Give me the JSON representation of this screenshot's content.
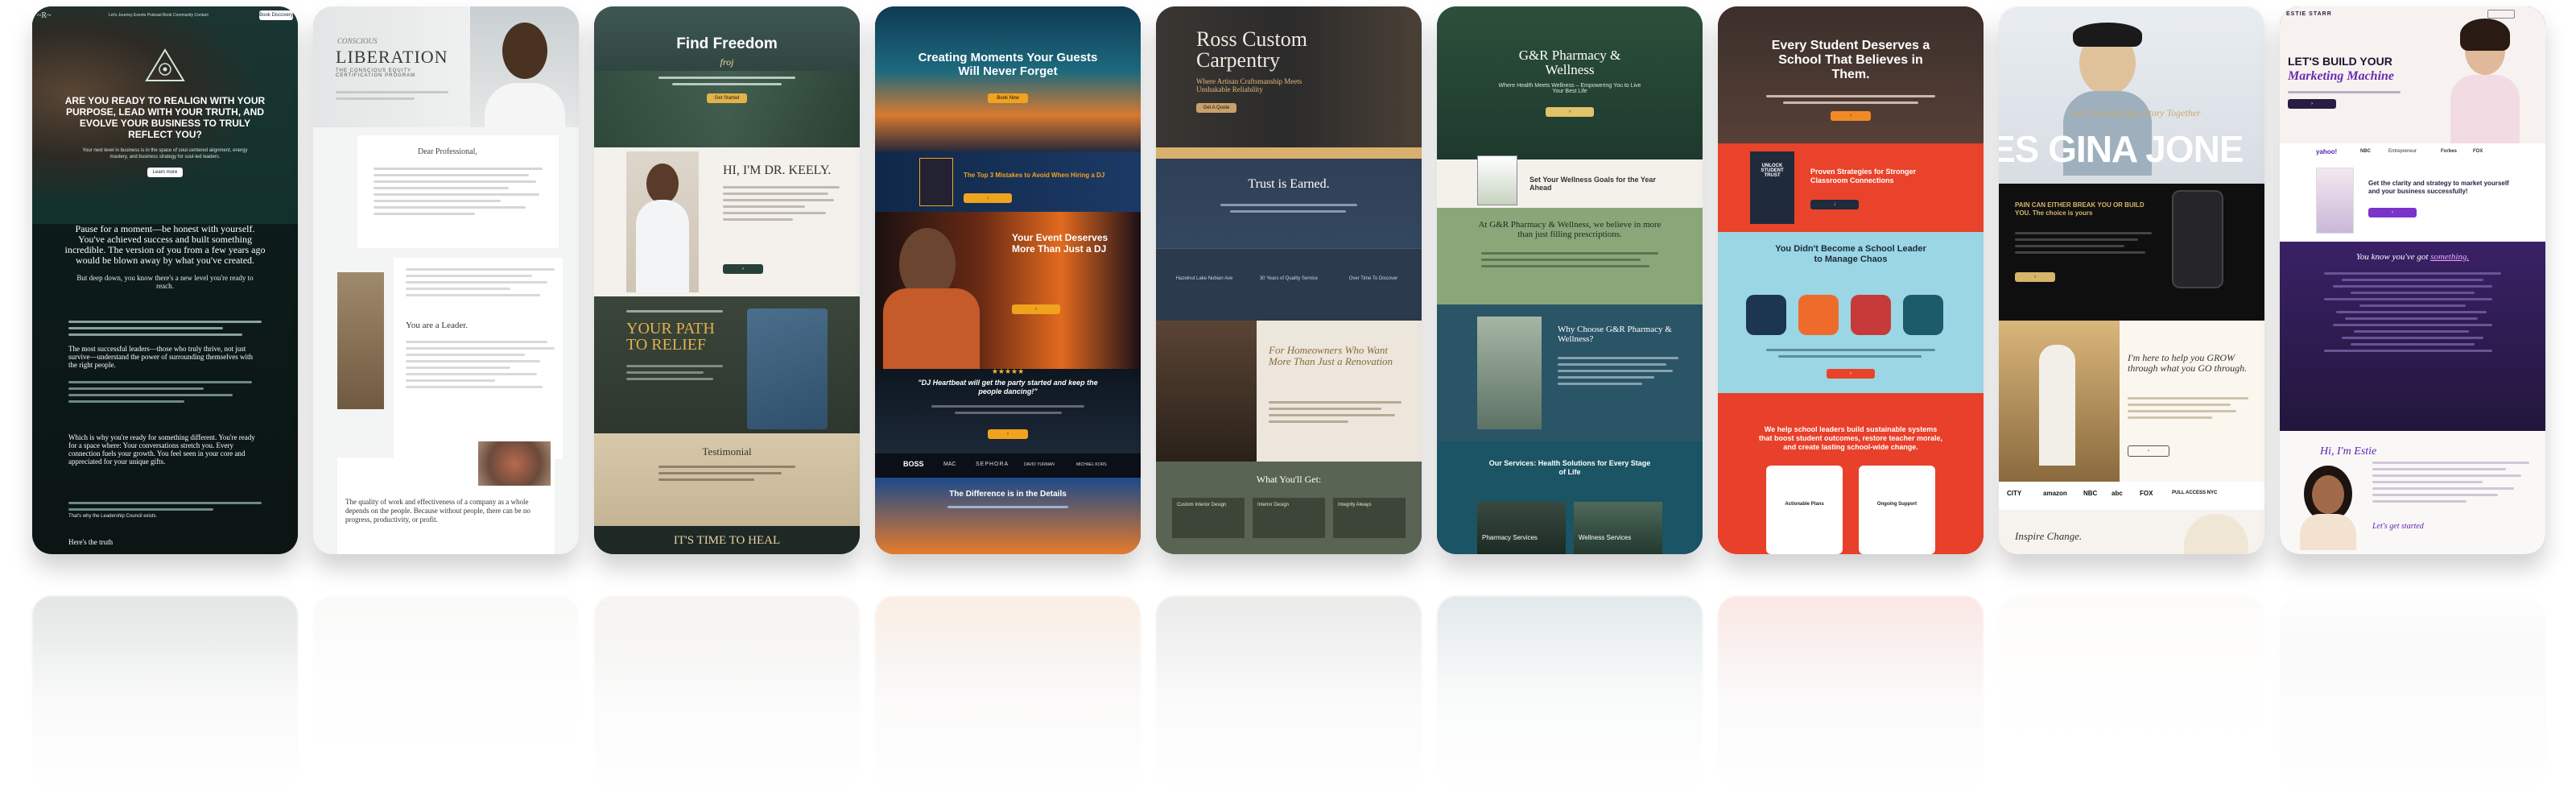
{
  "cards": [
    {
      "id": "soul-business",
      "nav_items": "Let's Journey  Events  Podcast  Book  Community  Contact",
      "nav_button": "Book Discovery",
      "headline": "ARE YOU READY TO REALIGN WITH YOUR PURPOSE, LEAD WITH YOUR TRUTH, AND EVOLVE YOUR BUSINESS TO TRULY REFLECT YOU?",
      "sub": "Your next level in business is in the space of soul-centered alignment, energy mastery, and business strategy for soul-led leaders.",
      "cta": "Learn more",
      "body_heading": "Pause for a moment—be honest with yourself. You've achieved success and built something incredible. The version of you from a few years ago would be blown away by what you've created.",
      "body_line": "But deep down, you know there's a new level you're ready to reach.",
      "quote1": "The most successful leaders—those who truly thrive, not just survive—understand the power of surrounding themselves with the right people.",
      "quote2": "Which is why you're ready for something different. You're ready for a space where: Your conversations stretch you. Every connection fuels your growth. You feel seen in your core and appreciated for your unique gifts.",
      "section": "That's why the Leadership Council exists.",
      "quote3": "Here's the truth"
    },
    {
      "id": "liberation",
      "brand_small": "CONSCIOUS",
      "title": "LIBERATION",
      "subtitle": "THE CONSCIOUS EQUITY CERTIFICATION PROGRAM",
      "greeting": "Dear Professional,",
      "section": "You are a Leader.",
      "quote": "The quality of work and effectiveness of a company as a whole depends on the people. Because without people, there can be no progress, productivity, or profit."
    },
    {
      "id": "find-freedom",
      "title": "Find Freedom",
      "script": "froj",
      "cta": "Get Started",
      "hi": "HI, I'M DR. KEELY.",
      "path1": "YOUR PATH",
      "path2": "TO RELIEF",
      "testimonial": "Testimonial",
      "bottom": "IT'S TIME TO HEAL"
    },
    {
      "id": "dj-events",
      "title": "Creating Moments Your Guests Will Never Forget",
      "cta": "Book Now",
      "promo": "The Top 3 Mistakes to Avoid When Hiring a DJ",
      "event": "Your Event Deserves More Than Just a DJ",
      "stars": "★★★★★",
      "review": "\"DJ Heartbeat will get the party started and keep the people dancing!\"",
      "logos": [
        "BOSS",
        "MAC",
        "SEPHORA",
        "DAVID YURMAN",
        "MICHAEL KORS"
      ],
      "difference": "The Difference is in the Details"
    },
    {
      "id": "ross-carpentry",
      "title1": "Ross Custom",
      "title2": "Carpentry",
      "tagline": "Where Artisan Craftsmanship Meets Unshakable Reliability",
      "cta": "Get A Quote",
      "trust": "Trust is Earned.",
      "stats": [
        "Hazelnut Lake Nubian Ave",
        "30 Years of Quality Service",
        "Over Time To Discover"
      ],
      "homeowners": "For Homeowners Who Want More Than Just a Renovation",
      "get": "What You'll Get:",
      "items": [
        "Custom Interior Design",
        "Interior Design",
        "Integrity Always"
      ]
    },
    {
      "id": "gr-pharmacy",
      "title": "G&R Pharmacy & Wellness",
      "tagline": "Where Health Meets Wellness – Empowering You to Live Your Best Life",
      "book": "Set Your Wellness Goals for the Year Ahead",
      "believe": "At G&R Pharmacy & Wellness, we believe in more than just filling prescriptions.",
      "why": "Why Choose G&R Pharmacy & Wellness?",
      "services": "Our Services: Health Solutions for Every Stage of Life",
      "cards": [
        "Pharmacy Services",
        "Wellness Services"
      ]
    },
    {
      "id": "every-student",
      "title": "Every Student Deserves a School That Believes in Them.",
      "book": "UNLOCK STUDENT TRUST",
      "proven": "Proven Strategies for Stronger Classroom Connections",
      "chaos": "You Didn't Become a School Leader to Manage Chaos",
      "mission": "We help school leaders build sustainable systems that boost student outcomes, restore teacher morale, and create lasting school-wide change.",
      "tiles": [
        "Actionable Plans",
        "Ongoing Support"
      ]
    },
    {
      "id": "gina-jones",
      "marquee": "ES GINA JONE",
      "script": "Let's Rewrite Your Story Together",
      "quote": "PAIN CAN EITHER BREAK YOU OR BUILD YOU. The choice is yours",
      "help": "I'm here to help you GROW through what you GO through.",
      "logos": [
        "CITY",
        "amazon",
        "NBC",
        "abc",
        "FOX",
        "PULL ACCESS NYC"
      ],
      "inspire": "Inspire Change."
    },
    {
      "id": "estie-starr",
      "logo": "ESTIE STARR",
      "title": "LET'S BUILD YOUR",
      "title_script": "Marketing Machine",
      "logos": [
        "yahoo!",
        "NBC",
        "Entrepreneur",
        "Forbes",
        "FOX"
      ],
      "clarity": "Get the clarity and strategy to market yourself and your business successfully!",
      "know": "You know you've got",
      "know_em": "something.",
      "hi": "Hi, I'm Estie",
      "sign": "Let's get started"
    }
  ]
}
